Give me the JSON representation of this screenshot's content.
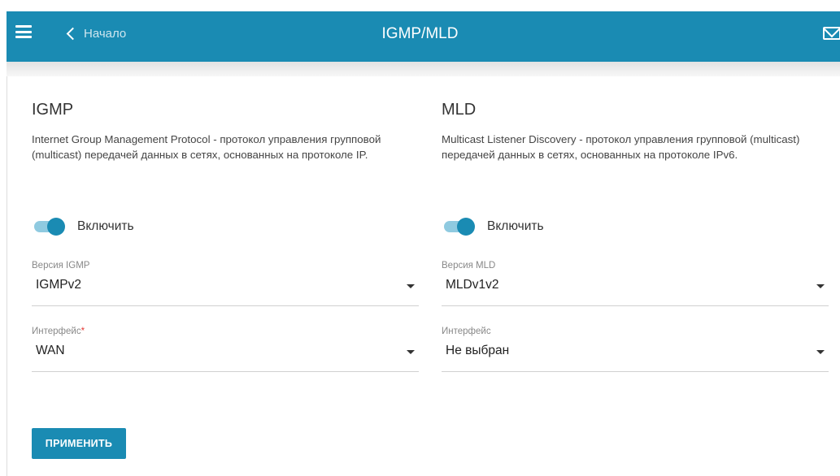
{
  "header": {
    "menu_icon": "hamburger-menu-icon",
    "back_label": "Начало",
    "title": "IGMP/MLD",
    "mail_icon": "mail-icon",
    "color": "#1a8bb3"
  },
  "igmp": {
    "title": "IGMP",
    "description": "Internet Group Management Protocol - протокол управления групповой (multicast) передачей данных в сетях, основанных на протоколе IP.",
    "enable_label": "Включить",
    "enabled": true,
    "version_label": "Версия IGMP",
    "version_value": "IGMPv2",
    "interface_label": "Интерфейс",
    "interface_required": "*",
    "interface_value": "WAN"
  },
  "mld": {
    "title": "MLD",
    "description": "Multicast Listener Discovery - протокол управления групповой (multicast) передачей данных в сетях, основанных на протоколе IPv6.",
    "enable_label": "Включить",
    "enabled": true,
    "version_label": "Версия MLD",
    "version_value": "MLDv1v2",
    "interface_label": "Интерфейс",
    "interface_value": "Не выбран"
  },
  "actions": {
    "apply_label": "ПРИМЕНИТЬ"
  }
}
